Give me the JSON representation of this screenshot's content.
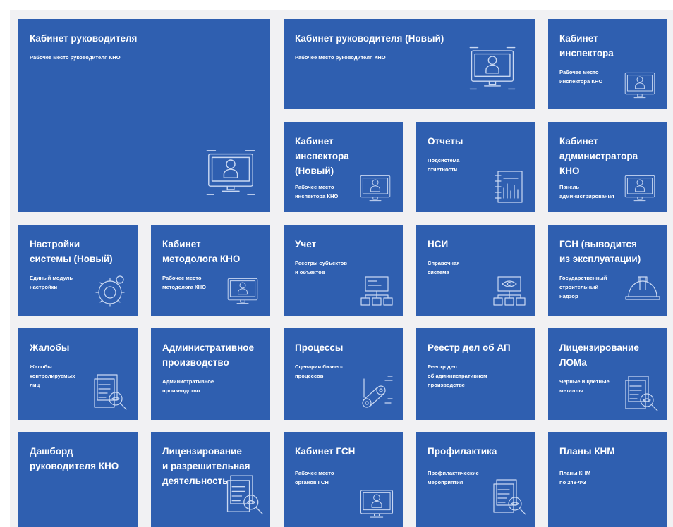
{
  "tiles": [
    {
      "title": "Кабинет руководителя",
      "subtitle": "Рабочее место руководителя КНО",
      "icon": "monitor-user-icon"
    },
    {
      "title": "Кабинет руководителя (Новый)",
      "subtitle": "Рабочее место руководителя КНО",
      "icon": "monitor-user-icon"
    },
    {
      "title": "Кабинет\nинспектора",
      "subtitle": "Рабочее место\nинспектора КНО",
      "icon": "monitor-user-icon"
    },
    {
      "title": "Кабинет\nинспектора\n(Новый)",
      "subtitle": "Рабочее место\nинспектора КНО",
      "icon": "monitor-user-icon"
    },
    {
      "title": "Отчеты",
      "subtitle": "Подсистема\nотчетности",
      "icon": "report-chart-icon"
    },
    {
      "title": "Кабинет\nадминистратора\nКНО",
      "subtitle": "Панель\nадминистрирования",
      "icon": "monitor-user-icon"
    },
    {
      "title": "Настройки\nсистемы (Новый)",
      "subtitle": "Единый модуль\nнастройки",
      "icon": "gears-icon"
    },
    {
      "title": "Кабинет\nметодолога КНО",
      "subtitle": "Рабочее место\nметодолога КНО",
      "icon": "monitor-user-icon"
    },
    {
      "title": "Учет",
      "subtitle": "Реестры субъектов\nи объектов",
      "icon": "hierarchy-icon"
    },
    {
      "title": "НСИ",
      "subtitle": "Справочная\nсистема",
      "icon": "hierarchy-eye-icon"
    },
    {
      "title": "ГСН (выводится\nиз эксплуатации)",
      "subtitle": "Государственный\nстроительный\nнадзор",
      "icon": "hard-hat-icon"
    },
    {
      "title": "Жалобы",
      "subtitle": "Жалобы\nконтролируемых\nлиц",
      "icon": "document-search-icon"
    },
    {
      "title": "Административное\nпроизводство",
      "subtitle": "Административное\nпроизводство",
      "icon": ""
    },
    {
      "title": "Процессы",
      "subtitle": "Сценарии бизнес-\nпроцессов",
      "icon": "conveyor-icon"
    },
    {
      "title": "Реестр дел об АП",
      "subtitle": "Реестр дел\nоб административном\nпроизводстве",
      "icon": ""
    },
    {
      "title": "Лицензирование\nЛОМа",
      "subtitle": "Черные и цветные\nметаллы",
      "icon": "document-search-icon"
    },
    {
      "title": "Дашборд\nруководителя КНО",
      "subtitle": "",
      "icon": ""
    },
    {
      "title": "Лицензирование\nи разрешительная\nдеятельность",
      "subtitle": "",
      "icon": "document-search-icon"
    },
    {
      "title": "Кабинет ГСН",
      "subtitle": "Рабочее место\nорганов ГСН",
      "icon": "monitor-user-icon"
    },
    {
      "title": "Профилактика",
      "subtitle": "Профилактические\nмероприятия",
      "icon": "document-search-icon"
    },
    {
      "title": "Планы КНМ",
      "subtitle": "Планы КНМ\nпо 248-ФЗ",
      "icon": ""
    }
  ],
  "colors": {
    "tile": "#2f5fb0",
    "background": "#f1f1f3",
    "icon_stroke": "#c9d8f2"
  }
}
